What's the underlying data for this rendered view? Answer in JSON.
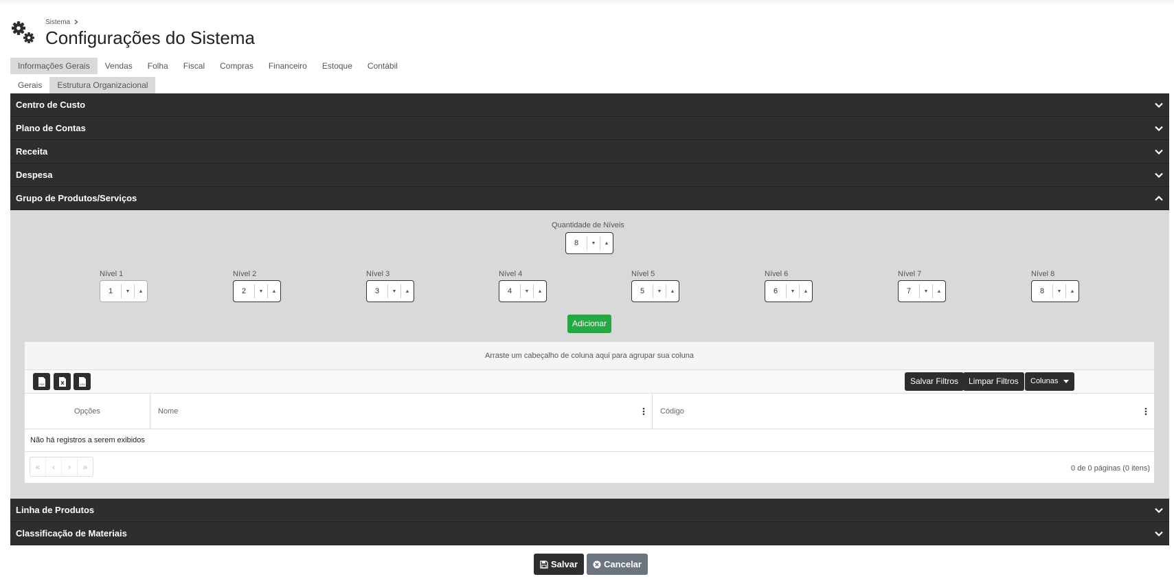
{
  "breadcrumb": {
    "parent": "Sistema"
  },
  "page_title": "Configurações do Sistema",
  "main_tabs": [
    "Informações Gerais",
    "Vendas",
    "Folha",
    "Fiscal",
    "Compras",
    "Financeiro",
    "Estoque",
    "Contábil"
  ],
  "sub_tabs": [
    "Gerais",
    "Estrutura Organizacional"
  ],
  "accordion": {
    "centro_custo": "Centro de Custo",
    "plano_contas": "Plano de Contas",
    "receita": "Receita",
    "despesa": "Despesa",
    "grupo_produtos": "Grupo de Produtos/Serviços",
    "linha_produtos": "Linha de Produtos",
    "classificacao": "Classificação de Materiais"
  },
  "quantidade": {
    "label": "Quantidade de Níveis",
    "value": "8"
  },
  "niveis": [
    {
      "label": "Nível 1",
      "value": "1"
    },
    {
      "label": "Nível 2",
      "value": "2"
    },
    {
      "label": "Nível 3",
      "value": "3"
    },
    {
      "label": "Nível 4",
      "value": "4"
    },
    {
      "label": "Nível 5",
      "value": "5"
    },
    {
      "label": "Nível 6",
      "value": "6"
    },
    {
      "label": "Nível 7",
      "value": "7"
    },
    {
      "label": "Nível 8",
      "value": "8"
    }
  ],
  "add_button": "Adicionar",
  "grid": {
    "group_hint": "Arraste um cabeçalho de coluna aqui para agrupar sua coluna",
    "export_icons": [
      "pdf-icon",
      "excel-icon",
      "csv-icon"
    ],
    "save_filters": "Salvar Filtros",
    "clear_filters": "Limpar Filtros",
    "columns_button": "Colunas",
    "columns": [
      "Opções",
      "Nome",
      "Código"
    ],
    "empty_text": "Não há registros a serem exibidos",
    "pager_info": "0 de 0 páginas (0 itens)"
  },
  "footer": {
    "save": "Salvar",
    "cancel": "Cancelar"
  },
  "colors": {
    "dark": "#2e2e2e",
    "green": "#28a745",
    "gray_button": "#6c757d",
    "panel": "#d9d9d9"
  }
}
